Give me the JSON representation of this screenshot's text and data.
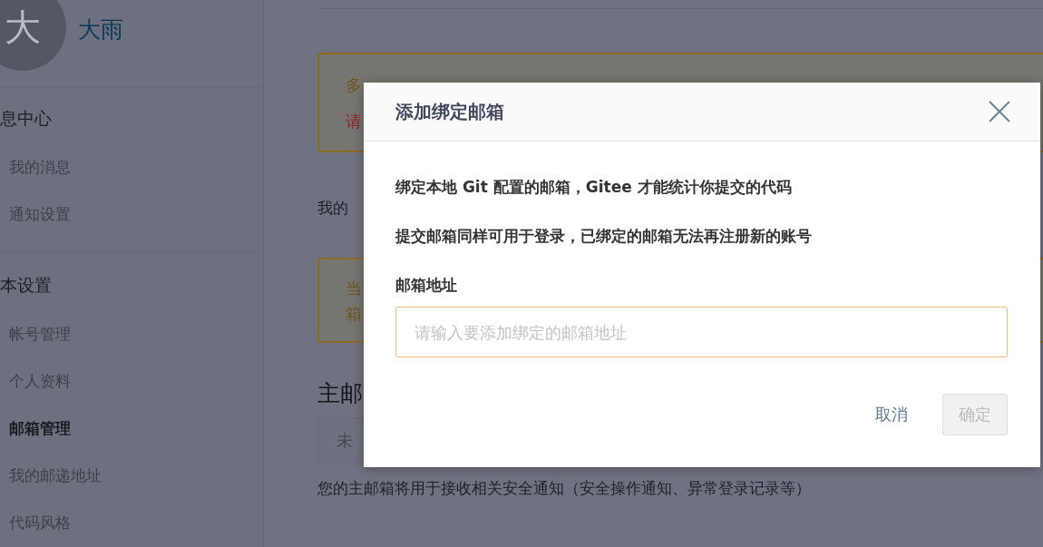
{
  "sidebar": {
    "avatar": {
      "initial": "大"
    },
    "user_name": "大雨",
    "sections": [
      {
        "title": "息中心",
        "items": [
          {
            "label": "我的消息",
            "selected": false
          },
          {
            "label": "通知设置",
            "selected": false
          }
        ]
      },
      {
        "title": "本设置",
        "items": [
          {
            "label": "帐号管理",
            "selected": false
          },
          {
            "label": "个人资料",
            "selected": false
          },
          {
            "label": "邮箱管理",
            "selected": true
          },
          {
            "label": "我的邮递地址",
            "selected": false
          },
          {
            "label": "代码风格",
            "selected": false
          }
        ]
      }
    ]
  },
  "content": {
    "notice_1": {
      "lines": [
        {
          "text": "多",
          "kind": "info"
        },
        {
          "text": "请",
          "kind": "warning"
        }
      ]
    },
    "intro_text": "我的",
    "notice_2": {
      "lines": [
        {
          "text": "当",
          "kind": "info"
        },
        {
          "text": "箱",
          "kind": "info"
        }
      ]
    },
    "primary_email_heading": "主邮",
    "primary_email_field": {
      "value": "未"
    },
    "primary_email_note": "您的主邮箱将用于接收相关安全通知（安全操作通知、异常登录记录等）"
  },
  "dialog": {
    "title": "添加绑定邮箱",
    "lines": [
      "绑定本地 Git 配置的邮箱，Gitee 才能统计你提交的代码",
      "提交邮箱同样可用于登录，已绑定的邮箱无法再注册新的账号"
    ],
    "field_label": "邮箱地址",
    "email_field": {
      "placeholder": "请输入要添加绑定的邮箱地址"
    },
    "buttons": [
      {
        "label": "取消",
        "kind": "text",
        "disabled": false
      },
      {
        "label": "确定",
        "kind": "primary",
        "disabled": true
      }
    ]
  }
}
